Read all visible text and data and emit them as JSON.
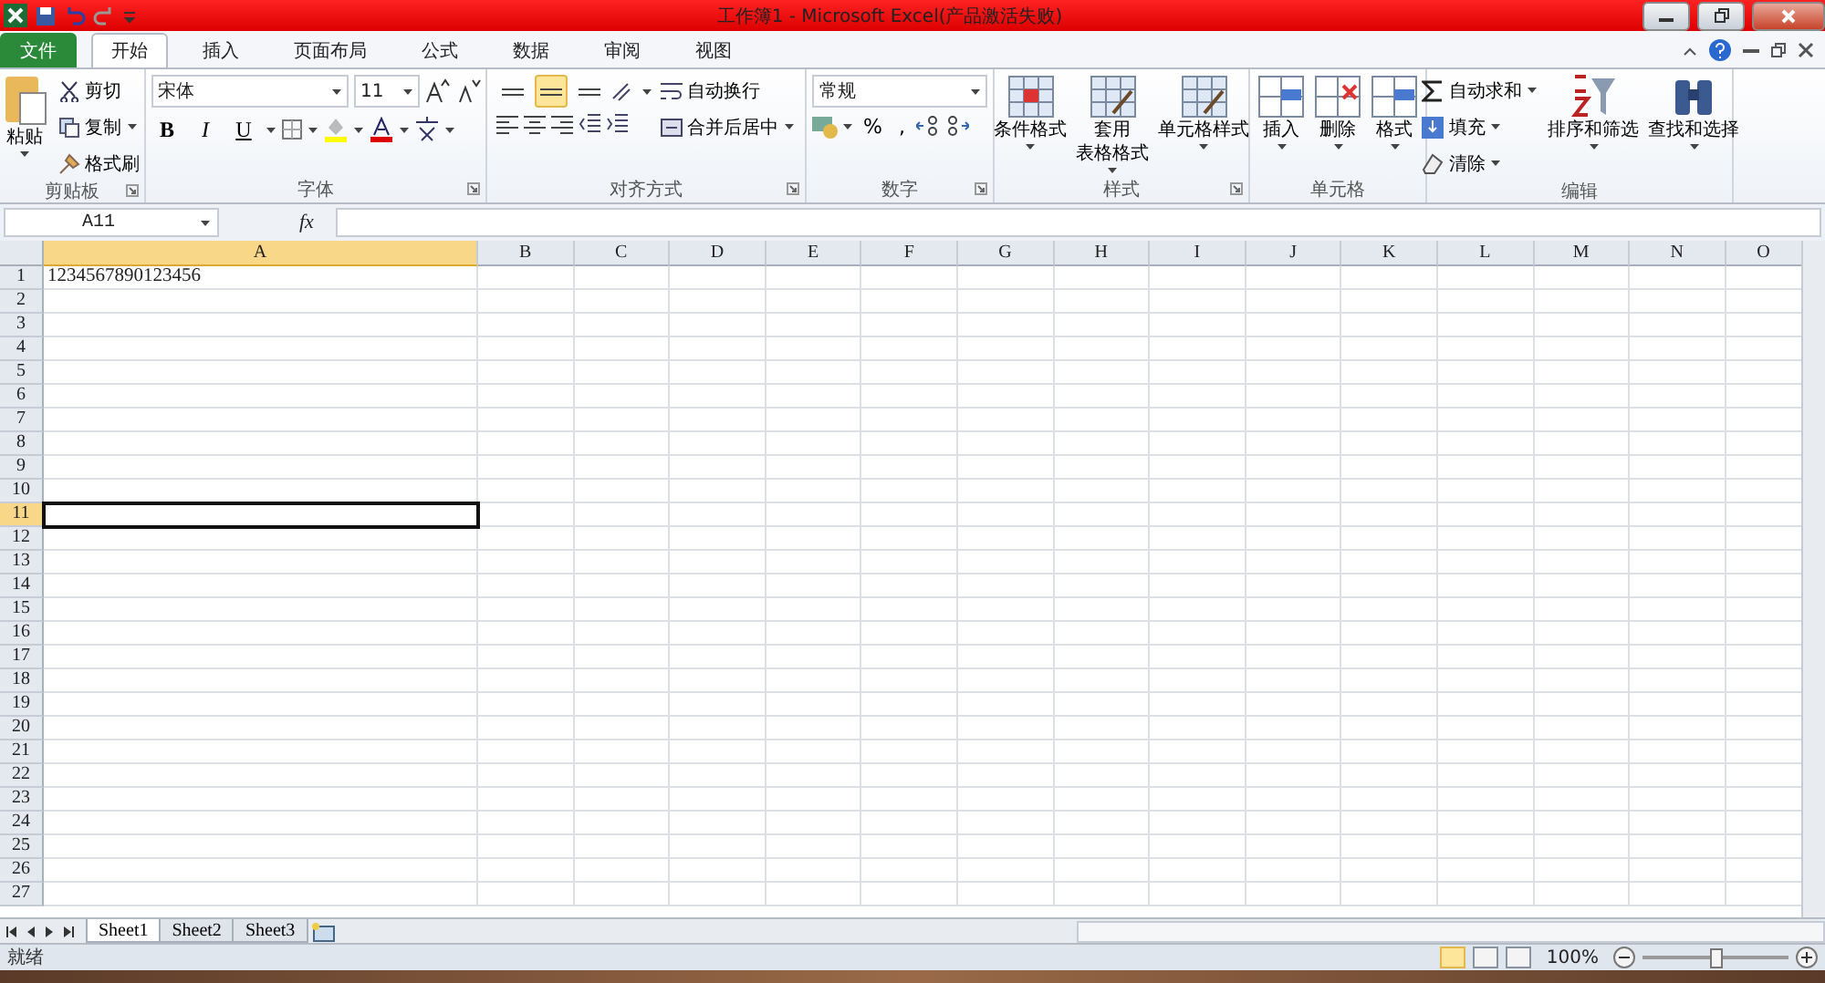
{
  "window": {
    "title": "工作簿1 - Microsoft Excel(产品激活失败)"
  },
  "tabs": [
    {
      "label": "文件",
      "kind": "file",
      "selected": false
    },
    {
      "label": "开始",
      "kind": "tab",
      "selected": true
    },
    {
      "label": "插入",
      "kind": "tab",
      "selected": false
    },
    {
      "label": "页面布局",
      "kind": "tab",
      "selected": false
    },
    {
      "label": "公式",
      "kind": "tab",
      "selected": false
    },
    {
      "label": "数据",
      "kind": "tab",
      "selected": false
    },
    {
      "label": "审阅",
      "kind": "tab",
      "selected": false
    },
    {
      "label": "视图",
      "kind": "tab",
      "selected": false
    }
  ],
  "ribbon": [
    {
      "kind": "clipboard",
      "label": "剪贴板",
      "launcher": true,
      "paste": "粘贴",
      "actions": [
        "剪切",
        "复制",
        "格式刷"
      ]
    },
    {
      "kind": "font",
      "label": "字体",
      "launcher": true,
      "font_name": "宋体",
      "font_size": "11",
      "styles": [
        "B",
        "I",
        "U"
      ]
    },
    {
      "kind": "alignment",
      "label": "对齐方式",
      "launcher": true,
      "vertical": [
        {
          "selected": false
        },
        {
          "selected": true
        },
        {
          "selected": false
        }
      ],
      "wrap": "自动换行",
      "merge": "合并后居中"
    },
    {
      "kind": "number",
      "label": "数字",
      "launcher": true,
      "format": "常规",
      "symbols": [
        "%",
        ","
      ]
    },
    {
      "kind": "styles",
      "label": "样式",
      "launcher": true,
      "buttons": [
        {
          "lines": [
            "条件格式"
          ]
        },
        {
          "lines": [
            "套用",
            "表格格式"
          ]
        },
        {
          "lines": [
            "单元格样式"
          ]
        }
      ]
    },
    {
      "kind": "cells",
      "label": "单元格",
      "launcher": false,
      "buttons": [
        {
          "lines": [
            "插入"
          ]
        },
        {
          "lines": [
            "删除"
          ]
        },
        {
          "lines": [
            "格式"
          ]
        }
      ]
    },
    {
      "kind": "editing",
      "label": "编辑",
      "launcher": false,
      "actions": [
        "自动求和",
        "填充",
        "清除"
      ],
      "buttons": [
        {
          "lines": [
            "排序和筛选"
          ]
        },
        {
          "lines": [
            "查找和选择"
          ]
        }
      ]
    }
  ],
  "formula_bar": {
    "name_box": "A11",
    "fx": "fx"
  },
  "grid": {
    "columns": [
      {
        "label": "A",
        "selected": true
      },
      {
        "label": "B",
        "selected": false
      },
      {
        "label": "C",
        "selected": false
      },
      {
        "label": "D",
        "selected": false
      },
      {
        "label": "E",
        "selected": false
      },
      {
        "label": "F",
        "selected": false
      },
      {
        "label": "G",
        "selected": false
      },
      {
        "label": "H",
        "selected": false
      },
      {
        "label": "I",
        "selected": false
      },
      {
        "label": "J",
        "selected": false
      },
      {
        "label": "K",
        "selected": false
      },
      {
        "label": "L",
        "selected": false
      },
      {
        "label": "M",
        "selected": false
      },
      {
        "label": "N",
        "selected": false
      },
      {
        "label": "O",
        "selected": false
      }
    ],
    "rows": [
      {
        "label": "1",
        "selected": false,
        "cells": [
          "1234567890123456"
        ]
      },
      {
        "label": "2",
        "selected": false
      },
      {
        "label": "3",
        "selected": false
      },
      {
        "label": "4",
        "selected": false
      },
      {
        "label": "5",
        "selected": false
      },
      {
        "label": "6",
        "selected": false
      },
      {
        "label": "7",
        "selected": false
      },
      {
        "label": "8",
        "selected": false
      },
      {
        "label": "9",
        "selected": false
      },
      {
        "label": "10",
        "selected": false
      },
      {
        "label": "11",
        "selected": true
      },
      {
        "label": "12",
        "selected": false
      },
      {
        "label": "13",
        "selected": false
      },
      {
        "label": "14",
        "selected": false
      },
      {
        "label": "15",
        "selected": false
      },
      {
        "label": "16",
        "selected": false
      },
      {
        "label": "17",
        "selected": false
      },
      {
        "label": "18",
        "selected": false
      },
      {
        "label": "19",
        "selected": false
      },
      {
        "label": "20",
        "selected": false
      },
      {
        "label": "21",
        "selected": false
      },
      {
        "label": "22",
        "selected": false
      },
      {
        "label": "23",
        "selected": false
      },
      {
        "label": "24",
        "selected": false
      },
      {
        "label": "25",
        "selected": false
      },
      {
        "label": "26",
        "selected": false
      },
      {
        "label": "27",
        "selected": false
      }
    ]
  },
  "sheets": [
    {
      "label": "Sheet1",
      "selected": true
    },
    {
      "label": "Sheet2",
      "selected": false
    },
    {
      "label": "Sheet3",
      "selected": false
    }
  ],
  "status_bar": {
    "status": "就绪",
    "views": [
      {
        "selected": true
      },
      {
        "selected": false
      },
      {
        "selected": false
      }
    ],
    "zoom": "100%",
    "zoom_slider": {
      "level": 0.5
    }
  }
}
